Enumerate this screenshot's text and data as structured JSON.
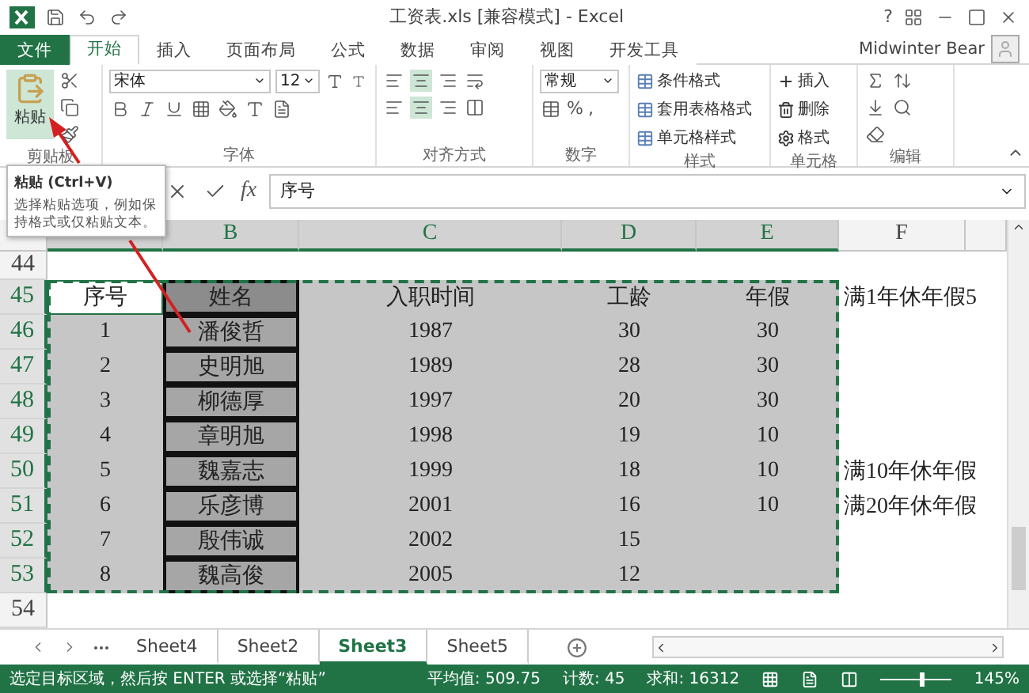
{
  "title_bar": {
    "title": "工资表.xls  [兼容模式] - Excel",
    "help": "?"
  },
  "ribbon_tabs": [
    {
      "label": "文件",
      "kind": "file",
      "selected": false
    },
    {
      "label": "开始",
      "kind": "tab",
      "selected": true
    },
    {
      "label": "插入",
      "kind": "tab",
      "selected": false
    },
    {
      "label": "页面布局",
      "kind": "tab",
      "selected": false
    },
    {
      "label": "公式",
      "kind": "tab",
      "selected": false
    },
    {
      "label": "数据",
      "kind": "tab",
      "selected": false
    },
    {
      "label": "审阅",
      "kind": "tab",
      "selected": false
    },
    {
      "label": "视图",
      "kind": "tab",
      "selected": false
    },
    {
      "label": "开发工具",
      "kind": "tab",
      "selected": false
    }
  ],
  "user": {
    "name": "Midwinter Bear"
  },
  "ribbon": {
    "clipboard": {
      "label": "剪贴板",
      "paste": "粘贴"
    },
    "font": {
      "label": "字体",
      "font_name": "宋体",
      "font_size": "12"
    },
    "alignment": {
      "label": "对齐方式"
    },
    "number": {
      "label": "数字",
      "format": "常规",
      "percent": "%",
      "comma": ","
    },
    "styles": {
      "label": "样式",
      "items": [
        "条件格式",
        "套用表格格式",
        "单元格样式"
      ]
    },
    "cells": {
      "label": "单元格",
      "items": [
        "插入",
        "删除",
        "格式"
      ]
    },
    "editing": {
      "label": "编辑"
    }
  },
  "formula_bar": {
    "fx": "fx",
    "value": "序号"
  },
  "tooltip": {
    "title": "粘贴 (Ctrl+V)",
    "text": "选择粘贴选项，例如保持格式或仅粘贴文本。"
  },
  "columns": [
    "B",
    "C",
    "D",
    "E",
    "F"
  ],
  "rows": [
    {
      "num": "44",
      "selected": false,
      "active": false,
      "cells": []
    },
    {
      "num": "45",
      "selected": true,
      "active": true,
      "cells": [
        "序号",
        "姓名",
        "入职时间",
        "工龄",
        "年假",
        "满1年休年假5"
      ]
    },
    {
      "num": "46",
      "selected": true,
      "active": false,
      "cells": [
        "1",
        "潘俊哲",
        "1987",
        "30",
        "30"
      ]
    },
    {
      "num": "47",
      "selected": true,
      "active": false,
      "cells": [
        "2",
        "史明旭",
        "1989",
        "28",
        "30"
      ]
    },
    {
      "num": "48",
      "selected": true,
      "active": false,
      "cells": [
        "3",
        "柳德厚",
        "1997",
        "20",
        "30"
      ]
    },
    {
      "num": "49",
      "selected": true,
      "active": false,
      "cells": [
        "4",
        "章明旭",
        "1998",
        "19",
        "10"
      ]
    },
    {
      "num": "50",
      "selected": true,
      "active": false,
      "cells": [
        "5",
        "魏嘉志",
        "1999",
        "18",
        "10",
        "满10年休年假"
      ]
    },
    {
      "num": "51",
      "selected": true,
      "active": false,
      "cells": [
        "6",
        "乐彦博",
        "2001",
        "16",
        "10",
        "满20年休年假"
      ]
    },
    {
      "num": "52",
      "selected": true,
      "active": false,
      "cells": [
        "7",
        "殷伟诚",
        "2002",
        "15"
      ]
    },
    {
      "num": "53",
      "selected": true,
      "active": false,
      "cells": [
        "8",
        "魏高俊",
        "2005",
        "12"
      ]
    },
    {
      "num": "54",
      "selected": false,
      "active": false,
      "cells": []
    }
  ],
  "sheet_tabs": [
    {
      "label": "Sheet4",
      "selected": false
    },
    {
      "label": "Sheet2",
      "selected": false
    },
    {
      "label": "Sheet3",
      "selected": true
    },
    {
      "label": "Sheet5",
      "selected": false
    }
  ],
  "status_bar": {
    "message": "选定目标区域，然后按 ENTER 或选择“粘贴”",
    "average": "平均值: 509.75",
    "count": "计数: 45",
    "sum": "求和: 16312",
    "zoom": "145%",
    "zoom_slider": {
      "level": 0.55
    }
  }
}
